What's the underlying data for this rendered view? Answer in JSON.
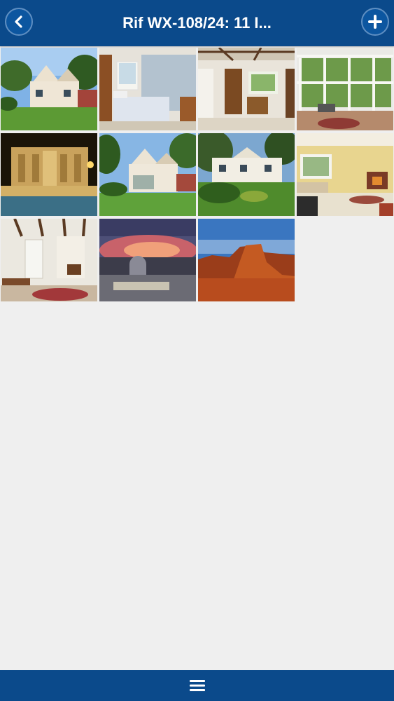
{
  "header": {
    "title": "Rif WX-108/24: 11 I...",
    "back_icon": "chevron-left-icon",
    "add_icon": "plus-icon"
  },
  "gallery": {
    "count": 11,
    "photos": [
      {
        "name": "photo-cottage-exterior"
      },
      {
        "name": "photo-bedroom"
      },
      {
        "name": "photo-dining-room"
      },
      {
        "name": "photo-conservatory"
      },
      {
        "name": "photo-trevi-fountain-night"
      },
      {
        "name": "photo-cottage-garden"
      },
      {
        "name": "photo-house-front-garden"
      },
      {
        "name": "photo-living-room"
      },
      {
        "name": "photo-hallway"
      },
      {
        "name": "photo-city-sunset"
      },
      {
        "name": "photo-desert-butte"
      }
    ]
  },
  "footer": {
    "menu_icon": "hamburger-menu-icon"
  },
  "colors": {
    "bar": "#0b4a8b",
    "background": "#efefef"
  }
}
